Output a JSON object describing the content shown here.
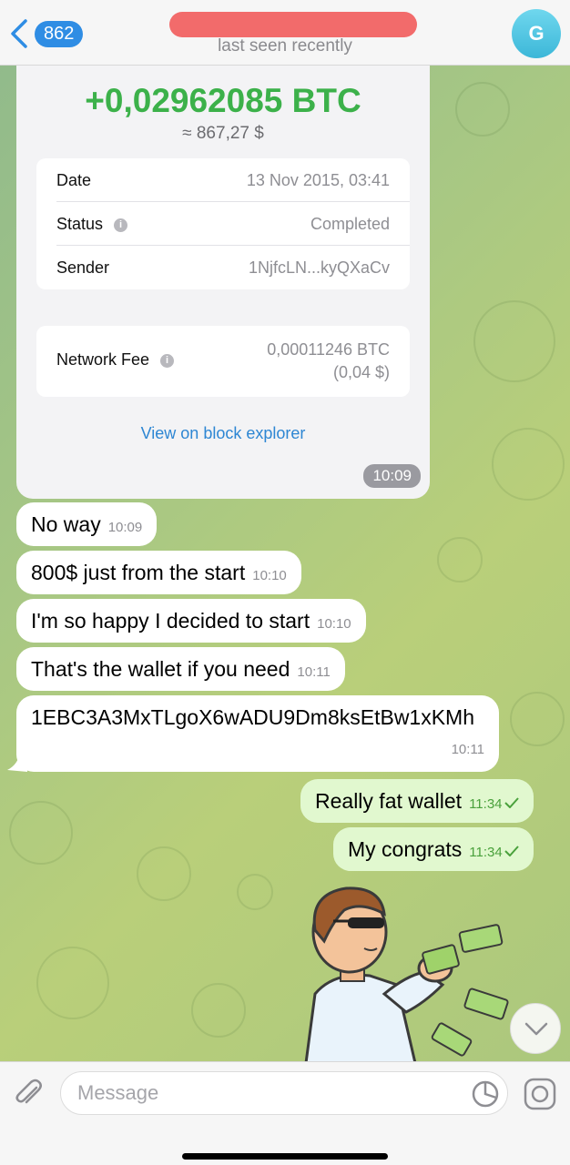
{
  "header": {
    "back_count": "862",
    "status": "last seen recently",
    "avatar_letter": "G"
  },
  "transaction": {
    "amount": "+0,02962085 BTC",
    "fiat": "≈ 867,27 $",
    "rows": [
      {
        "label": "Date",
        "value": "13 Nov 2015, 03:41"
      },
      {
        "label": "Status",
        "value": "Completed"
      },
      {
        "label": "Sender",
        "value": "1NjfcLN...kyQXaCv"
      }
    ],
    "fee_label": "Network Fee",
    "fee_btc": "0,00011246 BTC",
    "fee_fiat": "(0,04 $)",
    "link": "View on block explorer",
    "time": "10:09"
  },
  "messages": [
    {
      "text": "No way",
      "time": "10:09",
      "direction": "in"
    },
    {
      "text": "800$ just from the start",
      "time": "10:10",
      "direction": "in"
    },
    {
      "text": "I'm so happy I decided to start",
      "time": "10:10",
      "direction": "in"
    },
    {
      "text": "That's the wallet if you need",
      "time": "10:11",
      "direction": "in"
    },
    {
      "text": "1EBC3A3MxTLgoX6wADU9Dm8ksEtBw1xKMh",
      "time": "10:11",
      "direction": "in"
    },
    {
      "text": "Really fat wallet",
      "time": "11:34",
      "direction": "out"
    },
    {
      "text": "My congrats",
      "time": "11:34",
      "direction": "out"
    }
  ],
  "composer": {
    "placeholder": "Message"
  },
  "colors": {
    "accent": "#2f8de4",
    "btc_green": "#3cb14a",
    "outgoing_bubble": "#e1f8cf",
    "redaction": "#f26b6b"
  },
  "icons": [
    "back-chevron-icon",
    "info-icon",
    "check-icon",
    "chevron-down-icon",
    "paperclip-icon",
    "sticker-icon",
    "camera-icon"
  ]
}
